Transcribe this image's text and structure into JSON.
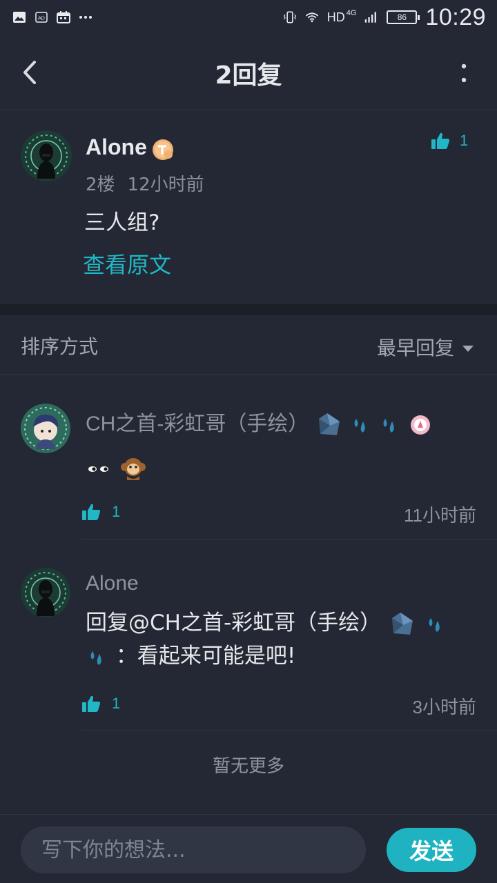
{
  "status_bar": {
    "network": "HD",
    "network_gen": "4G",
    "battery": "86",
    "time": "10:29",
    "icons": [
      "image-icon",
      "ad-icon",
      "calendar-icon",
      "more-dots-icon",
      "vibrate-icon",
      "wifi-icon",
      "signal-icon"
    ]
  },
  "nav": {
    "title": "2回复",
    "back_icon": "chevron-left-icon",
    "more_icon": "vertical-dots-icon"
  },
  "main_post": {
    "author": "Alone",
    "floor": "2楼",
    "time": "12小时前",
    "content": "三人组?",
    "likes": "1",
    "view_original": "查看原文"
  },
  "sort": {
    "label": "排序方式",
    "selected": "最早回复"
  },
  "replies": [
    {
      "author": "CH之首-彩虹哥（手绘）",
      "author_emojis": [
        "diamond-icon",
        "sweat-drop-icon",
        "sweat-drop-icon",
        "pink-badge-icon"
      ],
      "content_emojis": [
        "eyes-icon",
        "monkey-icon"
      ],
      "likes": "1",
      "time": "11小时前"
    },
    {
      "author": "Alone",
      "content_prefix": "回复@CH之首-彩虹哥（手绘）",
      "content_emojis": [
        "diamond-icon",
        "sweat-drop-icon",
        "sweat-drop-icon"
      ],
      "content_suffix": "：看起来可能是吧!",
      "likes": "1",
      "time": "3小时前"
    }
  ],
  "no_more": "暂无更多",
  "composer": {
    "placeholder": "写下你的想法...",
    "send_label": "发送"
  },
  "colors": {
    "background": "#232834",
    "accent": "#21b7c6",
    "secondary_text": "#8e939d"
  }
}
